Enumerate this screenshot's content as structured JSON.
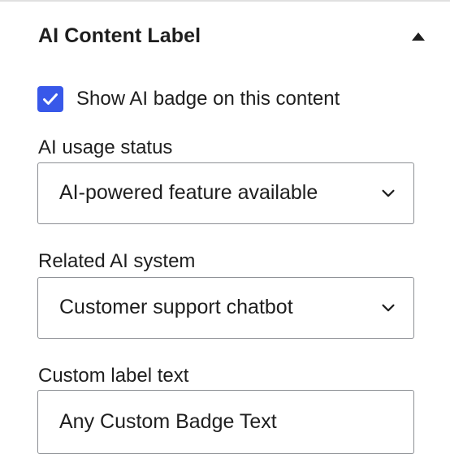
{
  "panel": {
    "title": "AI Content Label",
    "toggle_icon": "chevron-up-icon"
  },
  "show_badge": {
    "label": "Show AI badge on this content",
    "checked": true
  },
  "usage_status": {
    "label": "AI usage status",
    "value": "AI-powered feature available"
  },
  "related_system": {
    "label": "Related AI system",
    "value": "Customer support chatbot"
  },
  "custom_label": {
    "label": "Custom label text",
    "value": "Any Custom Badge Text"
  },
  "colors": {
    "accent": "#3858e9",
    "text": "#1e1e1e",
    "border": "#8c8f94"
  }
}
